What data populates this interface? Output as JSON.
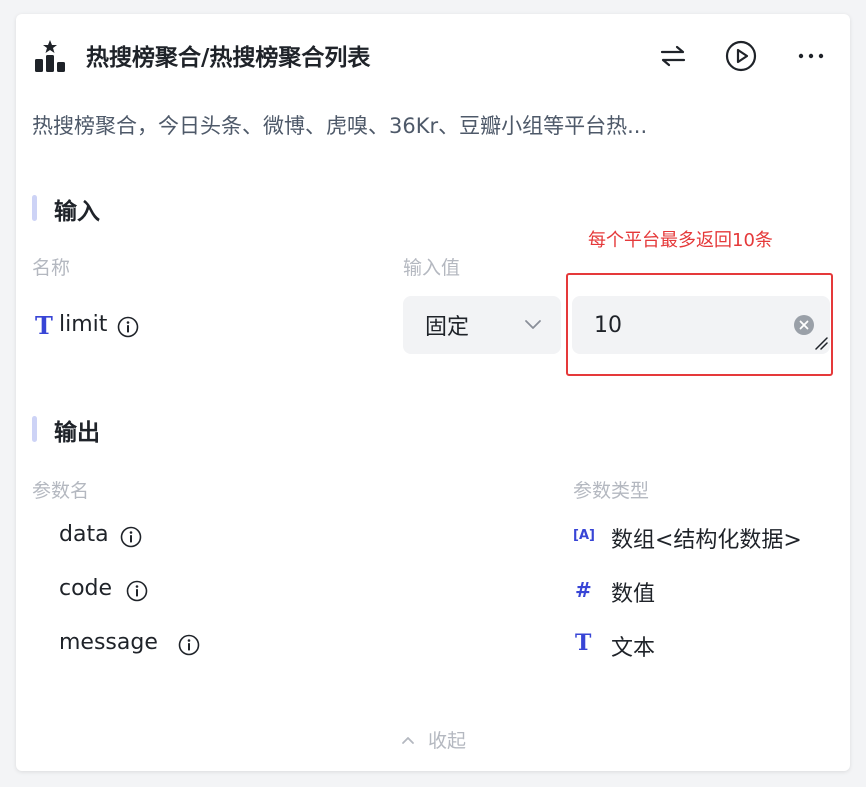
{
  "header": {
    "title": "热搜榜聚合/热搜榜聚合列表",
    "logo_icon": "ranking-icon",
    "actions": [
      "swap-icon",
      "play-circle-icon",
      "more-horizontal-icon"
    ]
  },
  "description": "热搜榜聚合，今日头条、微博、虎嗅、36Kr、豆瓣小组等平台热...",
  "input_section": {
    "title": "输入",
    "col_name": "名称",
    "col_value": "输入值",
    "annotation": "每个平台最多返回10条",
    "param": {
      "type_icon": "T",
      "name": "limit",
      "mode": "固定",
      "value": "10"
    }
  },
  "output_section": {
    "title": "输出",
    "col_name": "参数名",
    "col_type": "参数类型",
    "params": [
      {
        "name": "data",
        "type_icon": "[A]",
        "type": "数组<结构化数据>"
      },
      {
        "name": "code",
        "type_icon": "#",
        "type": "数值"
      },
      {
        "name": "message",
        "type_icon": "T",
        "type": "文本"
      }
    ]
  },
  "collapse_label": "收起",
  "colors": {
    "accent": "#3845d6",
    "annotation": "#e5393a",
    "section_bar": "#cdd3f6",
    "muted_text": "#b4b8c0"
  }
}
